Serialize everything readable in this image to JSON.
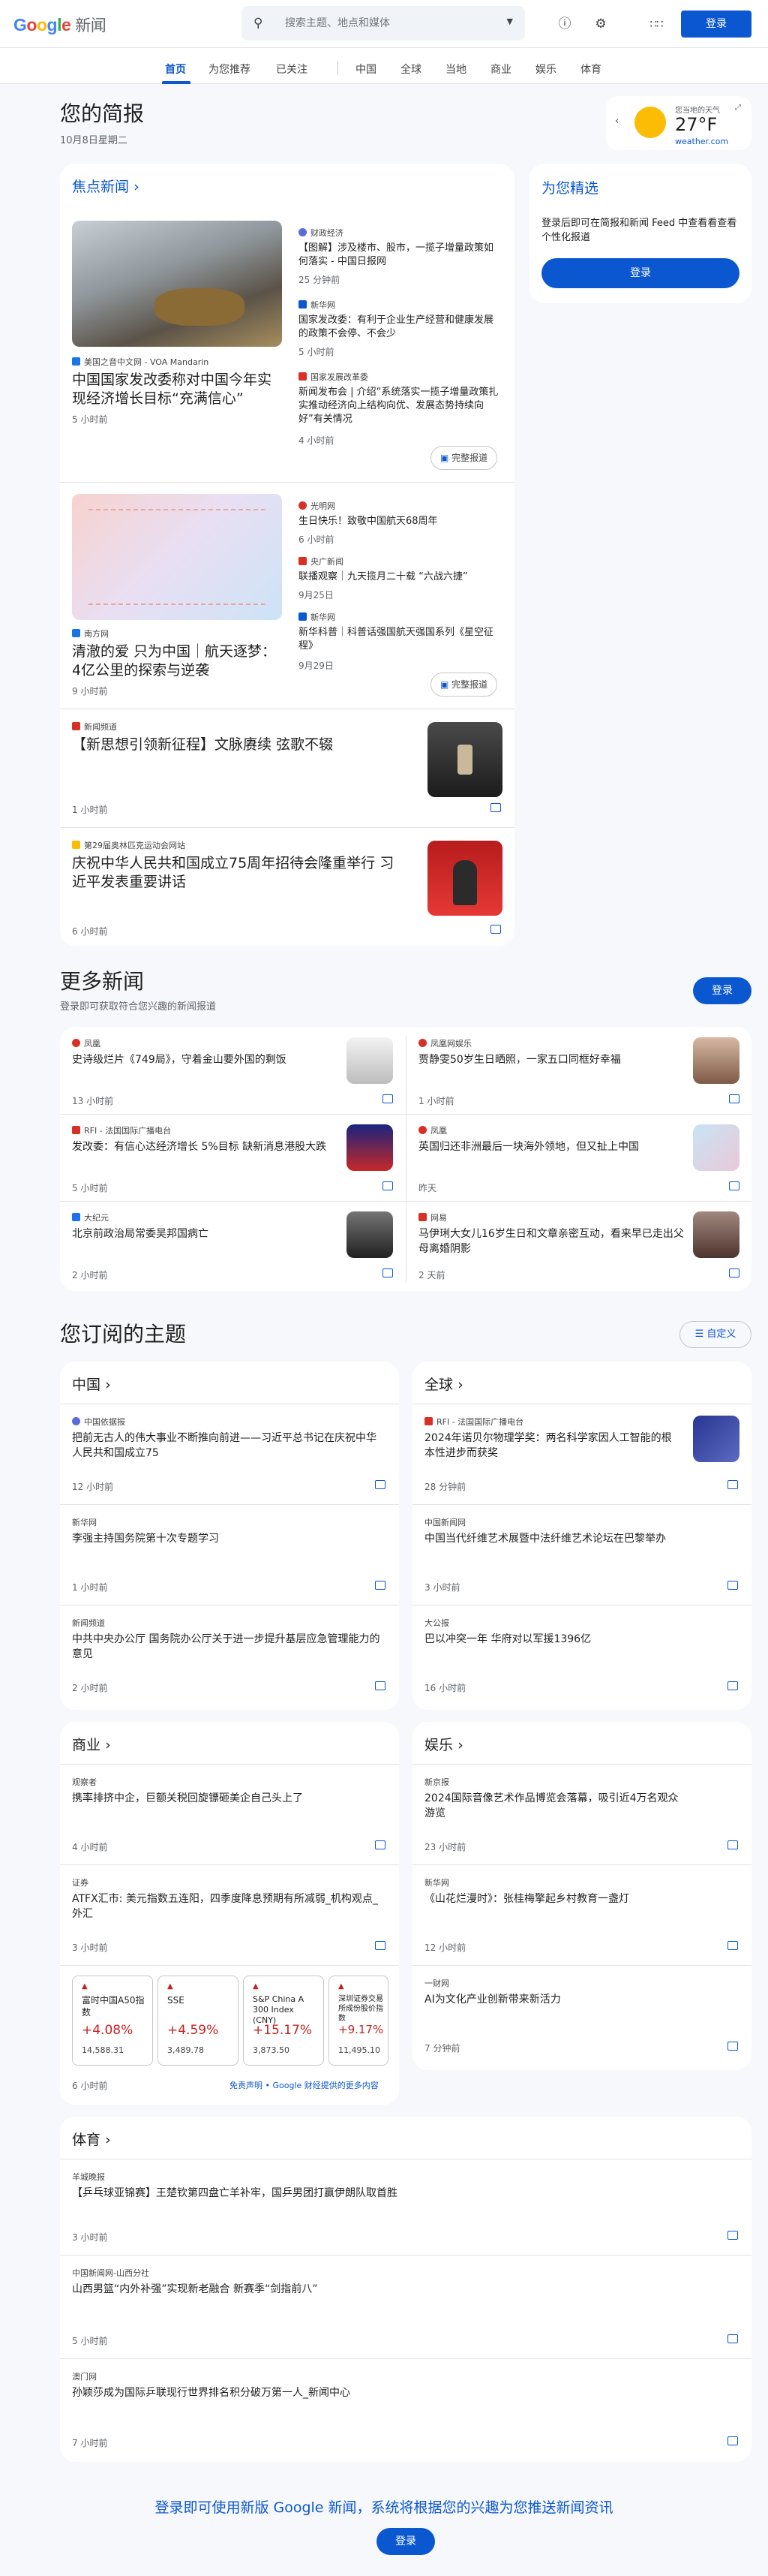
{
  "header": {
    "logo_word": "Google",
    "logo_suffix": "新闻",
    "search_placeholder": "搜索主题、地点和媒体",
    "sign_in": "登录"
  },
  "nav": {
    "tabs": [
      "首页",
      "为您推荐",
      "已关注",
      "中国",
      "全球",
      "当地",
      "商业",
      "娱乐",
      "体育"
    ]
  },
  "briefing": {
    "title": "您的简报",
    "date": "10月8日星期二"
  },
  "weather": {
    "label": "您当地的天气",
    "temp": "27°F",
    "source": "weather.com"
  },
  "for_you": {
    "title": "为您精选",
    "desc": "登录后即可在简报和新闻 Feed 中查看看查看个性化报道",
    "button": "登录"
  },
  "top_stories": {
    "title": "焦点新闻",
    "clusters": [
      {
        "main_source": "美国之音中文网 - VOA Mandarin",
        "main_title": "中国国家发改委称对中国今年实现经济增长目标“充满信心”",
        "main_time": "5 小时前",
        "side": [
          {
            "source": "财政经济",
            "title": "【图解】涉及楼市、股市，一揽子增量政策如何落实 - 中国日报网",
            "time": "25 分钟前"
          },
          {
            "source": "新华网",
            "title": "国家发改委：有利于企业生产经营和健康发展的政策不会停、不会少",
            "time": "5 小时前"
          },
          {
            "source": "国家发展改革委",
            "title": "新闻发布会 | 介绍“系统落实一揽子增量政策扎实推动经济向上结构向优、发展态势持续向好”有关情况",
            "time": "4 小时前"
          }
        ],
        "full": "完整报道"
      },
      {
        "main_source": "南方网",
        "main_title": "清澈的爱 只为中国｜航天逐梦：4亿公里的探索与逆袭",
        "main_time": "9 小时前",
        "side": [
          {
            "source": "光明网",
            "title": "生日快乐！致敬中国航天68周年",
            "time": "6 小时前"
          },
          {
            "source": "央广新闻",
            "title": "联播观察｜九天揽月二十载 “六战六捷”",
            "time": "9月25日"
          },
          {
            "source": "新华网",
            "title": "新华科普｜科普话强国航天强国系列《星空征程》",
            "time": "9月29日"
          }
        ],
        "full": "完整报道"
      }
    ],
    "singles": [
      {
        "source": "新闻频道",
        "title": "【新思想引领新征程】文脉赓续 弦歌不辍",
        "time": "1 小时前"
      },
      {
        "source": "第29届奥林匹克运动会网站",
        "title": "庆祝中华人民共和国成立75周年招待会隆重举行 习近平发表重要讲话",
        "time": "6 小时前"
      }
    ]
  },
  "more_news": {
    "title": "更多新闻",
    "subtitle": "登录即可获取符合您兴趣的新闻报道",
    "button": "登录",
    "items": [
      {
        "source": "凤凰",
        "title": "史诗级烂片《749局》，守着金山要外国的剩饭",
        "time": "13 小时前"
      },
      {
        "source": "凤凰网娱乐",
        "title": "贾静雯50岁生日晒照，一家五口同框好幸福",
        "time": "1 小时前"
      },
      {
        "source": "RFI - 法国国际广播电台",
        "title": "发改委：有信心达经济增长 5%目标 缺新消息港股大跌",
        "time": "5 小时前"
      },
      {
        "source": "凤凰",
        "title": "英国归还非洲最后一块海外领地，但又扯上中国",
        "time": "昨天"
      },
      {
        "source": "大纪元",
        "title": "北京前政治局常委吴邦国病亡",
        "time": "2 小时前"
      },
      {
        "source": "网易",
        "title": "马伊琍大女儿16岁生日和文章亲密互动，看来早已走出父母离婚阴影",
        "time": "2 天前"
      }
    ]
  },
  "topics": {
    "title": "您订阅的主题",
    "customize": "自定义",
    "china": {
      "title": "中国",
      "items": [
        {
          "source": "中国依据报",
          "title": "把前无古人的伟大事业不断推向前进——习近平总书记在庆祝中华人民共和国成立75",
          "time": "12 小时前"
        },
        {
          "source": "新华网",
          "title": "李强主持国务院第十次专题学习",
          "time": "1 小时前"
        },
        {
          "source": "新闻频道",
          "title": "中共中央办公厅 国务院办公厅关于进一步提升基层应急管理能力的意见",
          "time": "2 小时前"
        }
      ]
    },
    "world": {
      "title": "全球",
      "items": [
        {
          "source": "RFI - 法国国际广播电台",
          "title": "2024年诺贝尔物理学奖：两名科学家因人工智能的根本性进步而获奖",
          "time": "28 分钟前"
        },
        {
          "source": "中国新闻网",
          "title": "中国当代纤维艺术展暨中法纤维艺术论坛在巴黎举办",
          "time": "3 小时前"
        },
        {
          "source": "大公报",
          "title": "巴以冲突一年 华府对以军援1396亿",
          "time": "16 小时前"
        }
      ]
    },
    "business": {
      "title": "商业",
      "items": [
        {
          "source": "观察者",
          "title": "携率排挤中企，巨额关税回旋镖砸美企自己头上了",
          "time": "4 小时前"
        },
        {
          "source": "证券",
          "title": "ATFX汇市: 美元指数五连阳，四季度降息预期有所减弱_机构观点_外汇",
          "time": "3 小时前"
        }
      ],
      "tickers": [
        {
          "name": "富时中国A50指数",
          "change": "+4.08%",
          "value": "14,588.31"
        },
        {
          "name": "SSE",
          "change": "+4.59%",
          "value": "3,489.78"
        },
        {
          "name": "S&P China A 300 Index (CNY)",
          "change": "+15.17%",
          "value": "3,873.50"
        },
        {
          "name": "深圳证券交易所成份股价指数",
          "change": "+9.17%",
          "value": "11,495.10"
        }
      ],
      "ticker_time": "6 小时前",
      "disclaimer": "免责声明 • Google 财经提供的更多内容"
    },
    "entertainment": {
      "title": "娱乐",
      "items": [
        {
          "source": "新京报",
          "title": "2024国际音像艺术作品博览会落幕，吸引近4万名观众游览",
          "time": "23 小时前"
        },
        {
          "source": "新华网",
          "title": "《山花烂漫时》：张桂梅擎起乡村教育一盏灯",
          "time": "12 小时前"
        },
        {
          "source": "一财网",
          "title": "AI为文化产业创新带来新活力",
          "time": "7 分钟前"
        }
      ]
    },
    "sports": {
      "title": "体育",
      "items": [
        {
          "source": "羊城晚报",
          "title": "【乒乓球亚锦赛】王楚钦第四盘亡羊补牢，国乒男团打赢伊朗队取首胜",
          "time": "3 小时前"
        },
        {
          "source": "中国新闻网-山西分社",
          "title": "山西男篮“内外补强”实现新老融合 新赛季“剑指前八”",
          "time": "5 小时前"
        },
        {
          "source": "澳门网",
          "title": "孙颖莎成为国际乒联现行世界排名积分破万第一人_新闻中心",
          "time": "7 小时前"
        }
      ]
    }
  },
  "footer": {
    "text": "登录即可使用新版 Google 新闻，系统将根据您的兴趣为您推送新闻资讯",
    "button": "登录"
  },
  "colors": {
    "accent": "#0b57d0",
    "up": "#c5221f"
  }
}
